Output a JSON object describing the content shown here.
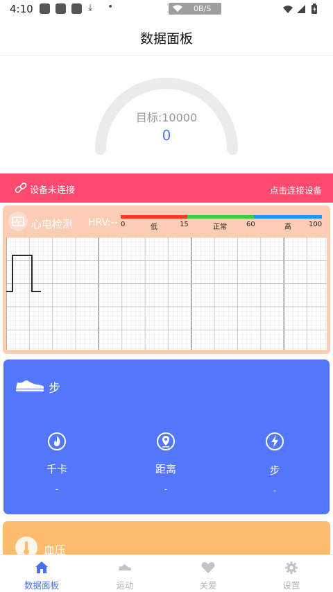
{
  "status_bar": {
    "time": "4:10",
    "net_rate": "0B/S"
  },
  "header": {
    "title": "数据面板"
  },
  "gauge": {
    "goal_label": "目标:10000",
    "value": "0",
    "progress": 0
  },
  "device": {
    "status": "设备未连接",
    "action": "点击连接设备"
  },
  "ecg": {
    "title": "心电检测",
    "hrv": "HRV:--",
    "scale_labels": [
      "0",
      "低",
      "15",
      "正常",
      "60",
      "高",
      "100"
    ],
    "zone_colors": [
      "#ff3b1f",
      "#46c83a",
      "#2196f3"
    ]
  },
  "steps_card": {
    "title": "步",
    "metrics": [
      {
        "label": "千卡",
        "value": "-",
        "icon": "fire-icon"
      },
      {
        "label": "距离",
        "value": "-",
        "icon": "location-pin-icon"
      },
      {
        "label": "步",
        "value": "-",
        "icon": "lightning-icon"
      }
    ]
  },
  "bp_card": {
    "title": "血压"
  },
  "bottom_nav": {
    "active_index": 0,
    "items": [
      {
        "label": "数据面板",
        "icon": "home-icon"
      },
      {
        "label": "运动",
        "icon": "shoe-icon"
      },
      {
        "label": "关爱",
        "icon": "heart-icon"
      },
      {
        "label": "设置",
        "icon": "gear-icon"
      }
    ]
  },
  "colors": {
    "accent_blue": "#5277fa",
    "alert_pink": "#ff4a70",
    "ecg_peach": "#fbcdb4",
    "bp_orange": "#fcbb6e"
  }
}
